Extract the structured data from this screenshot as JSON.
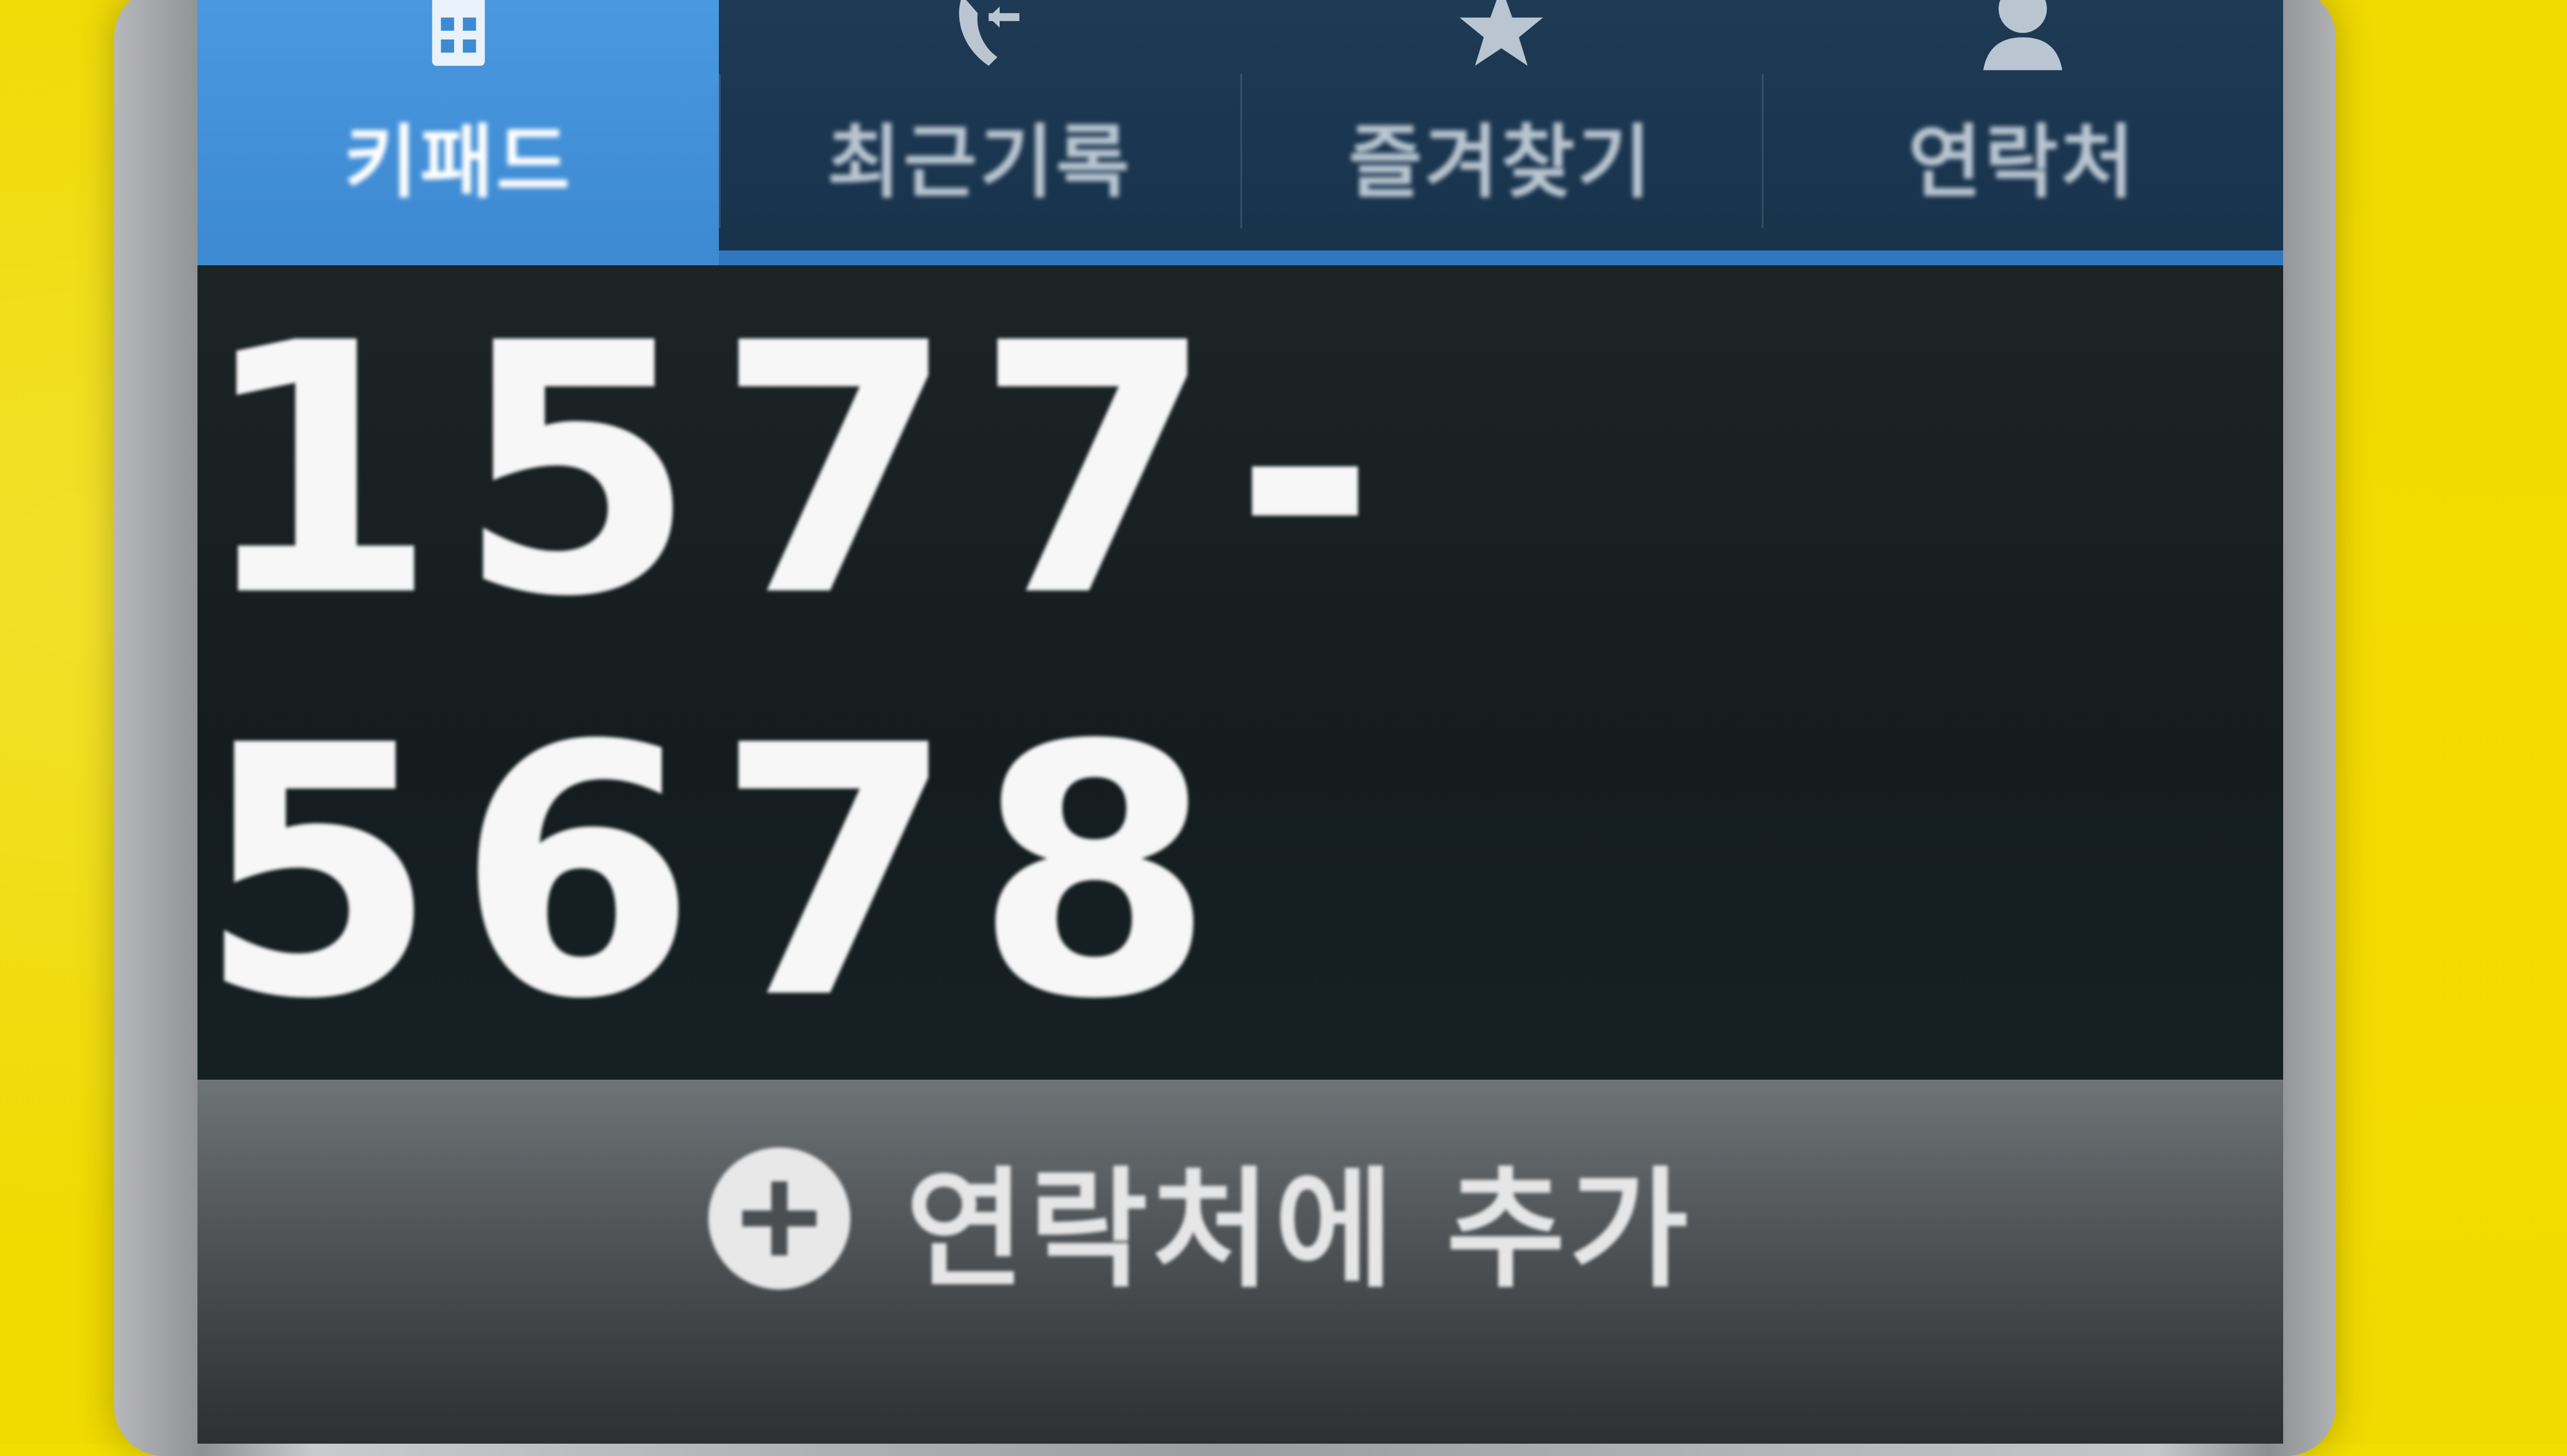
{
  "tabs": [
    {
      "label": "키패드",
      "icon": "keypad-icon",
      "active": true
    },
    {
      "label": "최근기록",
      "icon": "recent-calls-icon",
      "active": false
    },
    {
      "label": "즐겨찾기",
      "icon": "star-icon",
      "active": false
    },
    {
      "label": "연락처",
      "icon": "person-icon",
      "active": false
    }
  ],
  "display": {
    "number": "1577-5678"
  },
  "add_contact": {
    "label": "연락처에 추가",
    "icon": "plus-circle-icon"
  },
  "colors": {
    "background": "#f0da00",
    "active_tab": "#3d8ad2",
    "tab_bar": "#1f3a55",
    "screen": "#141c1e"
  }
}
